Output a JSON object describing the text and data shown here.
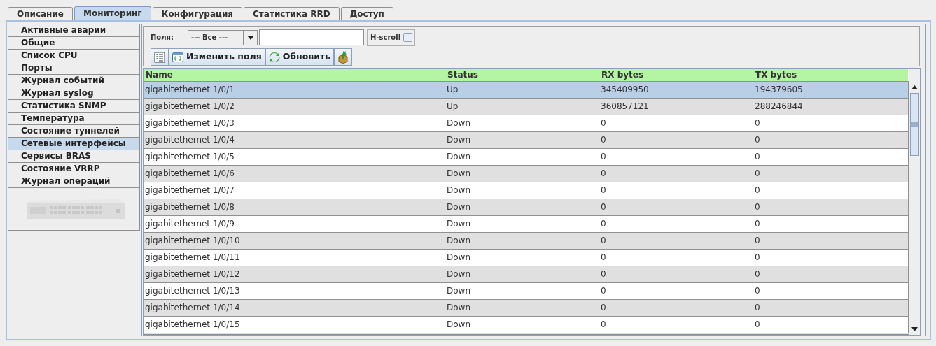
{
  "tabs": [
    {
      "label": "Описание",
      "selected": false
    },
    {
      "label": "Мониторинг",
      "selected": true
    },
    {
      "label": "Конфигурация",
      "selected": false
    },
    {
      "label": "Статистика RRD",
      "selected": false
    },
    {
      "label": "Доступ",
      "selected": false
    }
  ],
  "sidebar": {
    "items": [
      {
        "label": "Активные аварии",
        "selected": false
      },
      {
        "label": "Общие",
        "selected": false
      },
      {
        "label": "Список CPU",
        "selected": false
      },
      {
        "label": "Порты",
        "selected": false
      },
      {
        "label": "Журнал событий",
        "selected": false
      },
      {
        "label": "Журнал syslog",
        "selected": false
      },
      {
        "label": "Статистика SNMP",
        "selected": false
      },
      {
        "label": "Температура",
        "selected": false
      },
      {
        "label": "Состояние туннелей",
        "selected": false
      },
      {
        "label": "Сетевые интерфейсы",
        "selected": true
      },
      {
        "label": "Сервисы BRAS",
        "selected": false
      },
      {
        "label": "Состояние VRRP",
        "selected": false
      },
      {
        "label": "Журнал операций",
        "selected": false
      }
    ]
  },
  "filter": {
    "label": "Поля:",
    "dropdown_value": "--- Все ---",
    "hscroll_label": "H-scroll",
    "hscroll_checked": false
  },
  "toolbar": [
    {
      "kind": "list"
    },
    {
      "kind": "edit",
      "label": "Изменить поля"
    },
    {
      "kind": "refresh",
      "label": "Обновить"
    },
    {
      "kind": "export"
    }
  ],
  "table": {
    "columns": [
      "Name",
      "Status",
      "RX bytes",
      "TX bytes"
    ],
    "rows": [
      {
        "cells": [
          "gigabitethernet 1/0/1",
          "Up",
          "345409950",
          "194379605"
        ],
        "selected": true
      },
      {
        "cells": [
          "gigabitethernet 1/0/2",
          "Up",
          "360857121",
          "288246844"
        ],
        "selected": false
      },
      {
        "cells": [
          "gigabitethernet 1/0/3",
          "Down",
          "0",
          "0"
        ],
        "selected": false
      },
      {
        "cells": [
          "gigabitethernet 1/0/4",
          "Down",
          "0",
          "0"
        ],
        "selected": false
      },
      {
        "cells": [
          "gigabitethernet 1/0/5",
          "Down",
          "0",
          "0"
        ],
        "selected": false
      },
      {
        "cells": [
          "gigabitethernet 1/0/6",
          "Down",
          "0",
          "0"
        ],
        "selected": false
      },
      {
        "cells": [
          "gigabitethernet 1/0/7",
          "Down",
          "0",
          "0"
        ],
        "selected": false
      },
      {
        "cells": [
          "gigabitethernet 1/0/8",
          "Down",
          "0",
          "0"
        ],
        "selected": false
      },
      {
        "cells": [
          "gigabitethernet 1/0/9",
          "Down",
          "0",
          "0"
        ],
        "selected": false
      },
      {
        "cells": [
          "gigabitethernet 1/0/10",
          "Down",
          "0",
          "0"
        ],
        "selected": false
      },
      {
        "cells": [
          "gigabitethernet 1/0/11",
          "Down",
          "0",
          "0"
        ],
        "selected": false
      },
      {
        "cells": [
          "gigabitethernet 1/0/12",
          "Down",
          "0",
          "0"
        ],
        "selected": false
      },
      {
        "cells": [
          "gigabitethernet 1/0/13",
          "Down",
          "0",
          "0"
        ],
        "selected": false
      },
      {
        "cells": [
          "gigabitethernet 1/0/14",
          "Down",
          "0",
          "0"
        ],
        "selected": false
      },
      {
        "cells": [
          "gigabitethernet 1/0/15",
          "Down",
          "0",
          "0"
        ],
        "selected": false
      }
    ]
  }
}
